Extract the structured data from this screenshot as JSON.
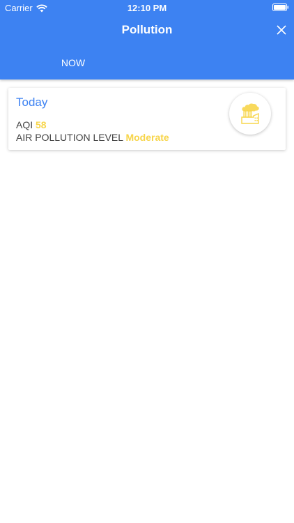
{
  "status_bar": {
    "carrier": "Carrier",
    "time": "12:10 PM",
    "wifi_icon": "wifi-icon",
    "battery_icon": "battery-icon"
  },
  "nav": {
    "title": "Pollution",
    "close_icon": "close-icon"
  },
  "tabs": [
    {
      "label": "NOW"
    }
  ],
  "card": {
    "title": "Today",
    "aqi_label": "AQI",
    "aqi_value": "58",
    "level_label": "AIR POLLUTION LEVEL",
    "level_value": "Moderate",
    "icon": "factory-pollution-icon"
  },
  "colors": {
    "header_blue": "#3d82f2",
    "accent_yellow": "#f7d54a",
    "text_gray": "#444444"
  }
}
